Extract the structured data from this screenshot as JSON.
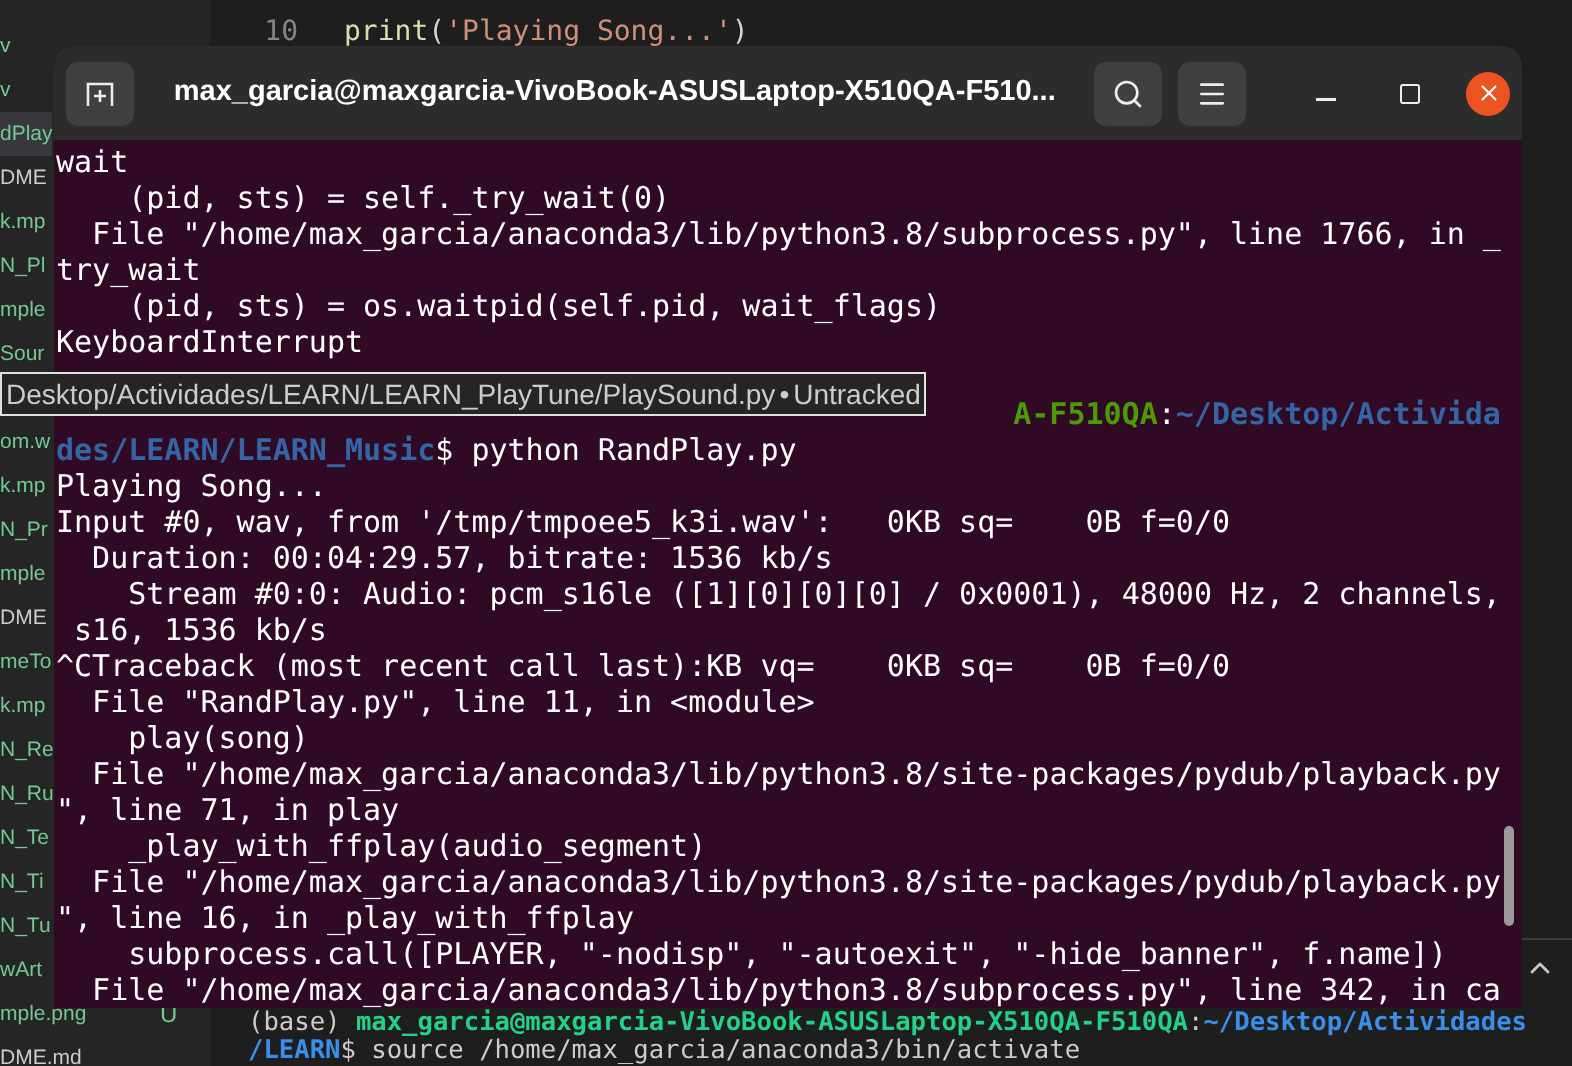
{
  "explorer": {
    "items": [
      {
        "text": "v",
        "color": "#73c991",
        "selected": false
      },
      {
        "text": "v",
        "color": "#73c991",
        "selected": false
      },
      {
        "text": "dPlay",
        "color": "#73c991",
        "selected": true
      },
      {
        "text": "DME",
        "color": "#cccccc",
        "selected": false
      },
      {
        "text": "k.mp",
        "color": "#73c991",
        "selected": false
      },
      {
        "text": "N_Pl",
        "color": "#73c991",
        "selected": false
      },
      {
        "text": "mple",
        "color": "#73c991",
        "selected": false
      },
      {
        "text": "Sour",
        "color": "#73c991",
        "selected": false
      }
    ],
    "items_below_tooltip": [
      {
        "text": "om.w",
        "color": "#73c991",
        "selected": false
      },
      {
        "text": "k.mp",
        "color": "#73c991",
        "selected": false
      },
      {
        "text": "N_Pr",
        "color": "#73c991",
        "selected": false
      },
      {
        "text": "mple",
        "color": "#73c991",
        "selected": false
      },
      {
        "text": "DME",
        "color": "#cccccc",
        "selected": false
      },
      {
        "text": "meTo",
        "color": "#73c991",
        "selected": false
      },
      {
        "text": "k.mp",
        "color": "#73c991",
        "selected": false
      },
      {
        "text": "N_Re",
        "color": "#73c991",
        "selected": false
      },
      {
        "text": "N_Ru",
        "color": "#73c991",
        "selected": false
      },
      {
        "text": "N_Te",
        "color": "#73c991",
        "selected": false
      },
      {
        "text": "N_Ti",
        "color": "#73c991",
        "selected": false
      },
      {
        "text": "N_Tu",
        "color": "#73c991",
        "selected": false
      },
      {
        "text": "wArt",
        "color": "#73c991",
        "selected": false
      },
      {
        "text": "mple.png",
        "color": "#73c991",
        "selected": false,
        "badge": "U"
      },
      {
        "text": "DME.md",
        "color": "#cccccc",
        "selected": false
      }
    ]
  },
  "editor": {
    "lines": [
      {
        "number": "10",
        "parts": [
          {
            "kind": "function",
            "text": "print"
          },
          {
            "kind": "plain",
            "text": "("
          },
          {
            "kind": "string",
            "text": "'Playing Song...'"
          },
          {
            "kind": "plain",
            "text": ")"
          }
        ]
      }
    ]
  },
  "integrated_terminal": {
    "lines": [
      [
        {
          "kind": "plain",
          "text": "(base) "
        },
        {
          "kind": "host",
          "text": "max_garcia@maxgarcia-VivoBook-ASUSLaptop-X510QA-F510QA"
        },
        {
          "kind": "plain",
          "text": ":"
        },
        {
          "kind": "path",
          "text": "~/Desktop/Actividades"
        }
      ],
      [
        {
          "kind": "path",
          "text": "/LEARN"
        },
        {
          "kind": "plain",
          "text": "$ source /home/max_garcia/anaconda3/bin/activate"
        }
      ]
    ]
  },
  "terminal_window": {
    "title": "max_garcia@maxgarcia-VivoBook-ASUSLaptop-X510QA-F510...",
    "lines": [
      [
        {
          "kind": "plain",
          "text": "wait"
        }
      ],
      [
        {
          "kind": "plain",
          "text": "    (pid, sts) = self._try_wait(0)"
        }
      ],
      [
        {
          "kind": "plain",
          "text": "  File \"/home/max_garcia/anaconda3/lib/python3.8/subprocess.py\", line 1766, in _"
        }
      ],
      [
        {
          "kind": "plain",
          "text": "try_wait"
        }
      ],
      [
        {
          "kind": "plain",
          "text": "    (pid, sts) = os.waitpid(self.pid, wait_flags)"
        }
      ],
      [
        {
          "kind": "plain",
          "text": "KeyboardInterrupt"
        }
      ],
      [
        {
          "kind": "host",
          "text": "A-F510QA"
        },
        {
          "kind": "plain",
          "text": ":"
        },
        {
          "kind": "path",
          "text": "~/Desktop/Activida"
        }
      ],
      [
        {
          "kind": "path",
          "text": "des/LEARN/LEARN_Music"
        },
        {
          "kind": "plain",
          "text": "$ python RandPlay.py"
        }
      ],
      [
        {
          "kind": "plain",
          "text": "Playing Song..."
        }
      ],
      [
        {
          "kind": "plain",
          "text": "Input #0, wav, from '/tmp/tmpoee5_k3i.wav':   0KB sq=    0B f=0/0"
        }
      ],
      [
        {
          "kind": "plain",
          "text": "  Duration: 00:04:29.57, bitrate: 1536 kb/s"
        }
      ],
      [
        {
          "kind": "plain",
          "text": "    Stream #0:0: Audio: pcm_s16le ([1][0][0][0] / 0x0001), 48000 Hz, 2 channels,"
        }
      ],
      [
        {
          "kind": "plain",
          "text": " s16, 1536 kb/s"
        }
      ],
      [
        {
          "kind": "plain",
          "text": "^CTraceback (most recent call last):KB vq=    0KB sq=    0B f=0/0"
        }
      ],
      [
        {
          "kind": "plain",
          "text": "  File \"RandPlay.py\", line 11, in <module>"
        }
      ],
      [
        {
          "kind": "plain",
          "text": "    play(song)"
        }
      ],
      [
        {
          "kind": "plain",
          "text": "  File \"/home/max_garcia/anaconda3/lib/python3.8/site-packages/pydub/playback.py"
        }
      ],
      [
        {
          "kind": "plain",
          "text": "\", line 71, in play"
        }
      ],
      [
        {
          "kind": "plain",
          "text": "    _play_with_ffplay(audio_segment)"
        }
      ],
      [
        {
          "kind": "plain",
          "text": "  File \"/home/max_garcia/anaconda3/lib/python3.8/site-packages/pydub/playback.py"
        }
      ],
      [
        {
          "kind": "plain",
          "text": "\", line 16, in _play_with_ffplay"
        }
      ],
      [
        {
          "kind": "plain",
          "text": "    subprocess.call([PLAYER, \"-nodisp\", \"-autoexit\", \"-hide_banner\", f.name])"
        }
      ],
      [
        {
          "kind": "plain",
          "text": "  File \"/home/max_garcia/anaconda3/lib/python3.8/subprocess.py\", line 342, in ca"
        }
      ]
    ]
  },
  "tooltip": {
    "path": "Desktop/Actividades/LEARN/LEARN_PlayTune/PlaySound.py",
    "separator": "•",
    "status": "Untracked"
  }
}
